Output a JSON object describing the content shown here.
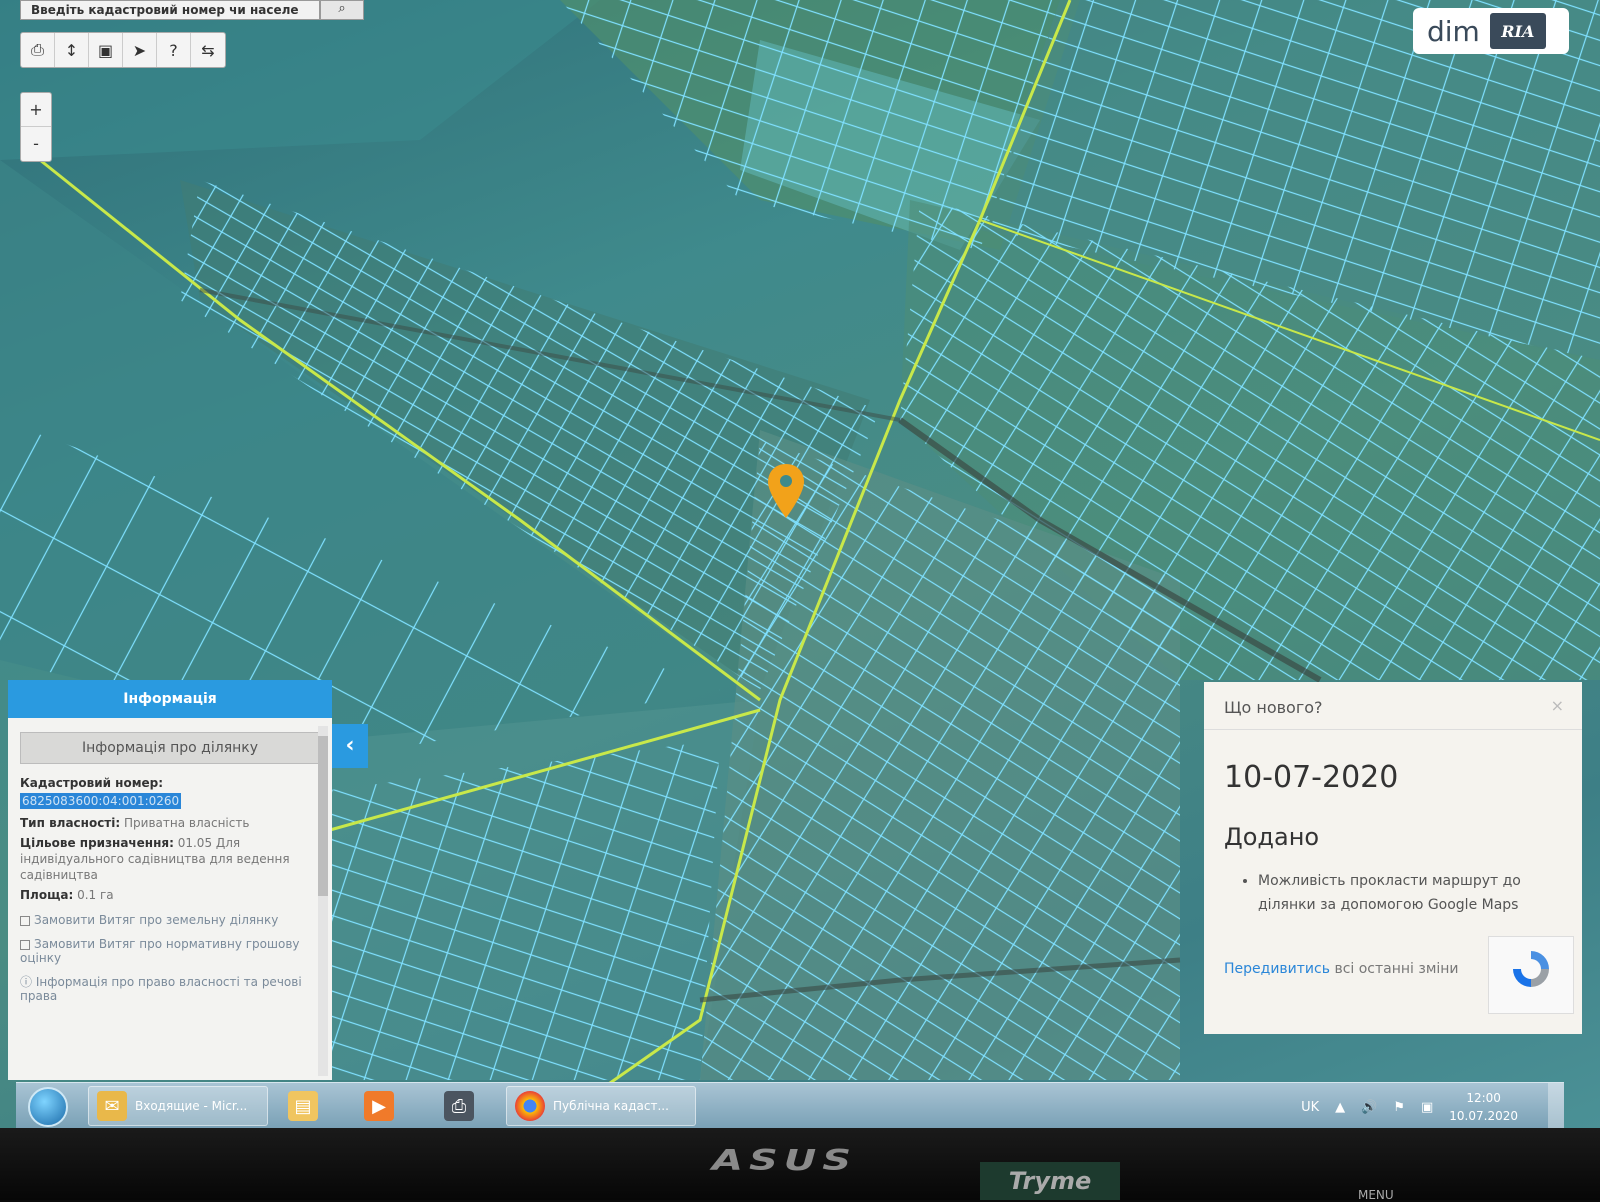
{
  "search": {
    "placeholder": "Введіть кадастровий номер чи населе",
    "button_icon": "search-icon"
  },
  "toolbar": {
    "tools": [
      "print-icon",
      "measure-length-icon",
      "measure-area-icon",
      "pointer-icon",
      "info-cursor-icon",
      "route-icon"
    ]
  },
  "zoom": {
    "in_label": "+",
    "out_label": "-"
  },
  "logo": {
    "dim": "dim",
    "ria": "RIA"
  },
  "info_panel": {
    "header": "Інформація",
    "tab": "Інформація про ділянку",
    "cadastral_label": "Кадастровий номер:",
    "cadastral_value": "6825083600:04:001:0260",
    "ownership_label": "Тип власності:",
    "ownership_value": "Приватна власність",
    "purpose_label": "Цільове призначення:",
    "purpose_value": "01.05 Для індивідуального садівництва для ведення садівництва",
    "area_label": "Площа:",
    "area_value": "0.1 га",
    "link1": "Замовити Витяг про земельну ділянку",
    "link2": "Замовити Витяг про нормативну грошову оцінку",
    "link3": "Інформація про право власності та речові права",
    "collapse_icon": "chevron-left-icon"
  },
  "news": {
    "title": "Що нового?",
    "close": "×",
    "date": "10-07-2020",
    "added": "Додано",
    "items": [
      "Можливість прокласти маршрут до ділянки за допомогою Google Maps"
    ],
    "link": "Передивитись",
    "link_tail": "всі останні зміни"
  },
  "taskbar": {
    "items": [
      {
        "icon": "explorer-icon",
        "label": "Входящие - Micr..."
      },
      {
        "icon": "folder-icon",
        "label": ""
      },
      {
        "icon": "media-player-icon",
        "label": ""
      },
      {
        "icon": "scanner-icon",
        "label": ""
      },
      {
        "icon": "chrome-icon",
        "label": "Публічна кадаст..."
      }
    ],
    "lang": "UK",
    "time": "12:00",
    "date": "10.07.2020"
  },
  "monitor": {
    "brand": "ASUS",
    "badge": "Tryme",
    "menu": "MENU"
  },
  "colors": {
    "accent": "#2a9ae0",
    "parcel_line": "#7fe0ff",
    "road": "#c8e84a",
    "pin": "#f2a21a"
  }
}
